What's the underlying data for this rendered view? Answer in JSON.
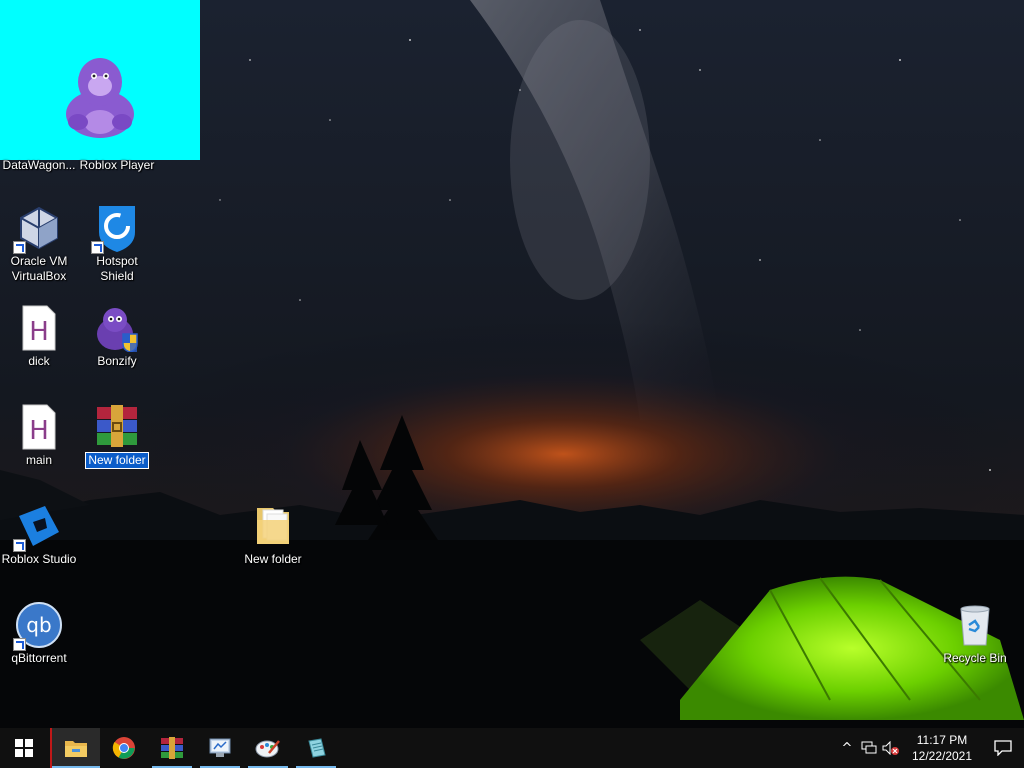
{
  "desktop": {
    "icons": [
      {
        "id": "datawagon",
        "label": "DataWagon..."
      },
      {
        "id": "roblox-player",
        "label": "Roblox Player"
      },
      {
        "id": "virtualbox",
        "label": "Oracle VM VirtualBox"
      },
      {
        "id": "hotspot",
        "label": "Hotspot Shield"
      },
      {
        "id": "dick",
        "label": "dick"
      },
      {
        "id": "bonzify",
        "label": "Bonzify"
      },
      {
        "id": "main",
        "label": "main"
      },
      {
        "id": "winrar-folder",
        "label": "New folder"
      },
      {
        "id": "roblox-studio",
        "label": "Roblox Studio"
      },
      {
        "id": "new-folder",
        "label": "New folder"
      },
      {
        "id": "qbittorrent",
        "label": "qBittorrent"
      },
      {
        "id": "recycle-bin",
        "label": "Recycle Bin"
      }
    ]
  },
  "taskbar": {
    "apps": [
      {
        "name": "file-explorer",
        "icon": "folder-icon",
        "active": true
      },
      {
        "name": "chrome",
        "icon": "chrome-icon",
        "active": false
      },
      {
        "name": "winrar",
        "icon": "winrar-icon",
        "active": false
      },
      {
        "name": "control-panel",
        "icon": "control-panel-icon",
        "active": false
      },
      {
        "name": "paint",
        "icon": "paint-icon",
        "active": false
      },
      {
        "name": "notes",
        "icon": "notepad-icon",
        "active": false
      }
    ],
    "tray": {
      "chevron": "^",
      "time": "11:17 PM",
      "date": "12/22/2021"
    }
  },
  "colors": {
    "overlay": "#00ffff",
    "bonzi_purple": "#8a5bd0",
    "tent_green": "#6cd000",
    "selection": "#0a5cc9",
    "taskbar": "#101010",
    "accent": "#76b9ed"
  }
}
